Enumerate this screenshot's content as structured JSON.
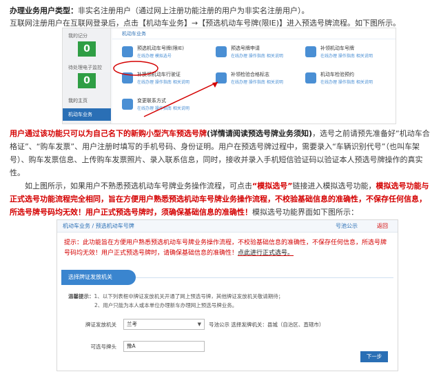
{
  "p1": {
    "label": "办理业务用户类型：",
    "text": "非实名注册用户（通过网上注册功能注册的用户为非实名注册用户）。"
  },
  "p2": "互联网注册用户在互联网登录后，点击【机动车业务】→【预选机动车号牌(限IE)】进入预选号牌流程。如下图所示。",
  "shot1": {
    "stat1_label": "我的记分",
    "stat1_value": "0",
    "stat2_label": "待处理电子监控",
    "stat2_value": "0",
    "nav_home": "我的主页",
    "nav_vehicle": "机动车业务",
    "header": "机动车业务",
    "services": [
      {
        "title": "预选机动车号牌(限IE)",
        "links": "在线办理  模拟选号"
      },
      {
        "title": "预选号牌申请",
        "links": "在线办理  操作指南  相关说明"
      },
      {
        "title": "补领机动车号牌",
        "links": "在线办理  操作指南  相关说明"
      },
      {
        "title": "补换领机动车行驶证",
        "links": "在线办理  操作指南  相关说明"
      },
      {
        "title": "补领检验合格标志",
        "links": "在线办理  操作指南  相关说明"
      },
      {
        "title": "机动车检验预约",
        "links": "在线办理  操作指南  相关说明"
      },
      {
        "title": "变更联系方式",
        "links": "在线办理  操作指南  相关说明"
      }
    ]
  },
  "p3": {
    "red": "用户通过该功能只可以为自己名下的新购小型汽车预选号牌",
    "bold": "(详情请阅读预选号牌业务须知)",
    "rest": "，选号之前请预先准备好“机动车合格证”、“购车发票”、用户注册时填写的手机号码、身份证明。用户在预选号牌过程中，需要录入“车辆识别代号”（也叫车架号）、购车发票信息、上传购车发票照片、录入联系信息，同时，接收并录入手机短信验证码以验证本人预选号牌操作的真实性。"
  },
  "p4": {
    "a": "如上图所示，如果用户不熟悉预选机动车号牌业务操作流程，可点击",
    "b": "“模拟选号”",
    "c": "链接进入模拟选号功能，",
    "d": "模拟选号功能与正式选号功能流程完全相同，旨在方便用户熟悉预选机动车号牌业务操作流程，不校验基础信息的准确性，不保存任何信息，所选号牌号码均无效！用户正式预选号牌时，须确保基础信息的准确性！",
    "e": "模拟选号功能界面如下图所示："
  },
  "shot2": {
    "breadcrumb": "机动车业务 / 预选机动车号牌",
    "right1": "号池公示",
    "right2": "返回",
    "tip": "提示：此功能旨在方便用户熟悉预选机动车号牌业务操作流程，不校验基础信息的准确性，不保存任何信息，所选号牌号码均无效！用户正式预选号牌时，请确保基础信息的准确性！",
    "tip_link": "点此进行正式选号。",
    "tab": "选择牌证发放机关",
    "hint_title": "温馨提示：",
    "hint1": "1、以下列表框中牌证发放机关开通了网上预选号牌，其他牌证发放机关敬请期待；",
    "hint2": "2、用户只能为本人或本单位办理新车办理网上预选号牌业务。",
    "f1_label": "牌证发放机关",
    "f1_value": "兰考",
    "f1_note": "号池公示  选择发牌机关：县城（自治区、直辖市）",
    "f2_label": "可选号牌头",
    "f2_value": "豫A",
    "next": "下一步"
  }
}
